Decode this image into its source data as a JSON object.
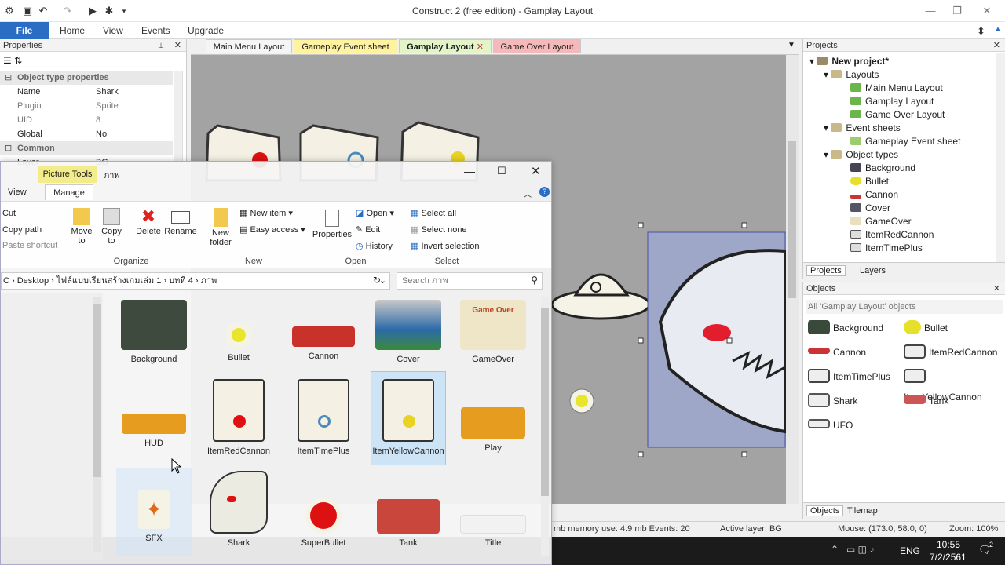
{
  "app": {
    "title": "Construct 2  (free edition) - Gamplay Layout",
    "ribbon_tabs": [
      "File",
      "Home",
      "View",
      "Events",
      "Upgrade"
    ]
  },
  "properties": {
    "header": "Properties",
    "section_object": "Object type properties",
    "rows": [
      {
        "key": "Name",
        "value": "Shark"
      },
      {
        "key": "Plugin",
        "value": "Sprite"
      },
      {
        "key": "UID",
        "value": "8"
      },
      {
        "key": "Global",
        "value": "No"
      }
    ],
    "section_common": "Common",
    "partial_layer": {
      "key": "Layer",
      "value": "BG"
    }
  },
  "layout_tabs": [
    "Main Menu Layout",
    "Gameplay Event sheet",
    "Gamplay Layout",
    "Game Over Layout"
  ],
  "projects": {
    "header": "Projects",
    "root": "New project*",
    "tree": [
      {
        "label": "Layouts",
        "level": 1,
        "kind": "folder"
      },
      {
        "label": "Main Menu Layout",
        "level": 2,
        "kind": "layout"
      },
      {
        "label": "Gamplay Layout",
        "level": 2,
        "kind": "layout"
      },
      {
        "label": "Game Over Layout",
        "level": 2,
        "kind": "layout"
      },
      {
        "label": "Event sheets",
        "level": 1,
        "kind": "folder"
      },
      {
        "label": "Gameplay Event sheet",
        "level": 2,
        "kind": "sheet"
      },
      {
        "label": "Object types",
        "level": 1,
        "kind": "folder"
      },
      {
        "label": "Background",
        "level": 2,
        "kind": "bg"
      },
      {
        "label": "Bullet",
        "level": 2,
        "kind": "bullet"
      },
      {
        "label": "Cannon",
        "level": 2,
        "kind": "cannon"
      },
      {
        "label": "Cover",
        "level": 2,
        "kind": "cover"
      },
      {
        "label": "GameOver",
        "level": 2,
        "kind": "gameover"
      },
      {
        "label": "ItemRedCannon",
        "level": 2,
        "kind": "item"
      },
      {
        "label": "ItemTimePlus",
        "level": 2,
        "kind": "item"
      }
    ],
    "tabs": [
      "Projects",
      "Layers"
    ]
  },
  "objects": {
    "header": "Objects",
    "filter": "All 'Gamplay Layout' objects",
    "items": [
      "Background",
      "Bullet",
      "Cannon",
      "ItemRedCannon",
      "ItemTimePlus",
      "ItemYellowCannon",
      "Shark",
      "Tank",
      "UFO"
    ],
    "tabs": [
      "Objects",
      "Tilemap"
    ]
  },
  "status": {
    "memory": "mb  memory use: 4.9 mb  Events: 20",
    "layer": "Active layer: BG",
    "mouse": "Mouse: (173.0, 58.0, 0)",
    "zoom": "Zoom: 100%"
  },
  "taskbar": {
    "lang": "ENG",
    "time": "10:55",
    "date": "7/2/2561",
    "notif": "2"
  },
  "explorer": {
    "tabs": {
      "context": "Picture Tools",
      "title": "ภาพ",
      "view": "View",
      "manage": "Manage"
    },
    "clipboard": [
      "Cut",
      "Copy path",
      "Paste shortcut"
    ],
    "organize": {
      "move": "Move to",
      "copy": "Copy to",
      "delete": "Delete",
      "rename": "Rename",
      "label": "Organize"
    },
    "new": {
      "folder": "New folder",
      "item": "New item",
      "easy": "Easy access",
      "label": "New"
    },
    "open": {
      "props": "Properties",
      "open": "Open",
      "edit": "Edit",
      "history": "History",
      "label": "Open"
    },
    "select": {
      "all": "Select all",
      "none": "Select none",
      "invert": "Invert selection",
      "label": "Select"
    },
    "path": [
      "C",
      "Desktop",
      "ไฟล์แบบเรียนสร้างเกมเล่ม 1",
      "บทที่ 4",
      "ภาพ"
    ],
    "search_placeholder": "Search ภาพ",
    "files": [
      "Background",
      "Bullet",
      "Cannon",
      "Cover",
      "GameOver",
      "HUD",
      "ItemRedCannon",
      "ItemTimePlus",
      "ItemYellowCannon",
      "Play",
      "SFX",
      "Shark",
      "SuperBullet",
      "Tank",
      "Title"
    ],
    "gameover_text": "Game Over"
  },
  "colors": {
    "accent": "#2b6cc4",
    "canvas": "#a3a3a3",
    "selection": "#9fa7c9"
  }
}
